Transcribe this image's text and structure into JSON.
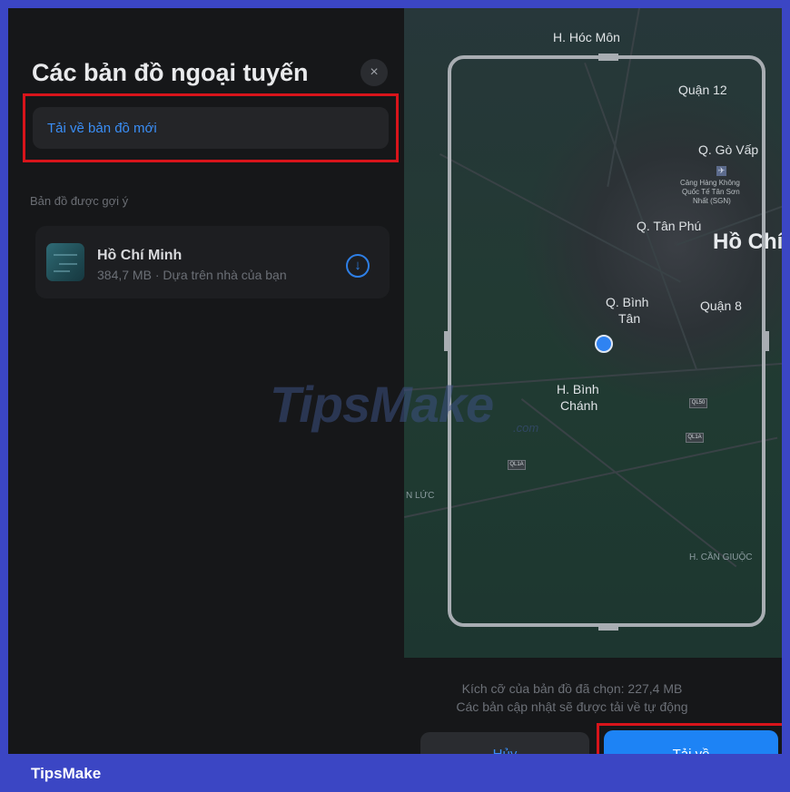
{
  "sheet": {
    "title": "Các bản đồ ngoại tuyến",
    "close_icon": "×",
    "download_new_label": "Tải về bản đồ mới",
    "suggested_label": "Bản đồ được gợi ý",
    "suggested_item": {
      "name": "Hồ Chí Minh",
      "meta": "384,7 MB · Dựa trên nhà của bạn",
      "download_icon": "↓"
    }
  },
  "map": {
    "labels": {
      "hoc_mon": "H. Hóc Môn",
      "quan12": "Quận 12",
      "go_vap": "Q. Gò Vấp",
      "airport_1": "Cảng Hàng Không",
      "airport_2": "Quốc Tế Tân Sơn",
      "airport_3": "Nhất (SGN)",
      "tan_phu": "Q. Tân Phú",
      "ho_chi": "Hồ Chí",
      "binh_tan_1": "Q. Bình",
      "binh_tan_2": "Tân",
      "quan8": "Quận 8",
      "binh_chanh_1": "H. Bình",
      "binh_chanh_2": "Chánh",
      "n_luc": "N LỨC",
      "can_giuoc": "H. CẦN GIUỘC",
      "shield_ql1a": "QL1A",
      "shield_ql50": "QL50",
      "shield_ql1a_2": "QL1A"
    }
  },
  "bottom": {
    "size_text": "Kích cỡ của bản đồ đã chọn: 227,4 MB",
    "update_text": "Các bản cập nhật sẽ được tải về tự động",
    "cancel_label": "Hủy",
    "download_label": "Tải về"
  },
  "watermark": {
    "main": "TipsMake",
    "suffix": ".com"
  },
  "brand": {
    "text": "TipsMake"
  },
  "colors": {
    "accent_blue": "#1d83f5",
    "highlight_red": "#d8141b",
    "frame_blue": "#3b46c4"
  }
}
